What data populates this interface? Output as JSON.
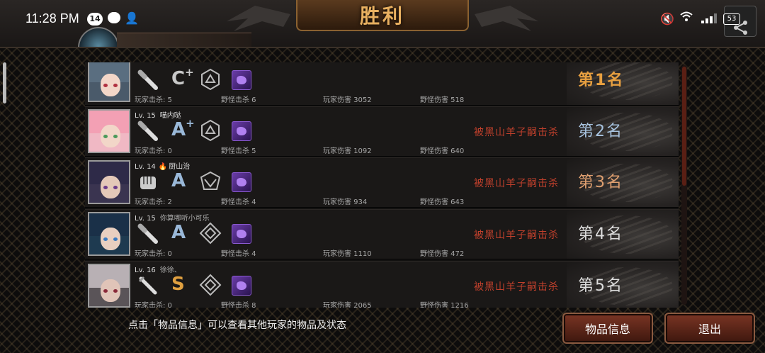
{
  "status_bar": {
    "time": "11:28 PM",
    "notification_count": "14",
    "battery": "53"
  },
  "header": {
    "title": "胜利"
  },
  "players": [
    {
      "level": "",
      "name": "",
      "grade": "C",
      "grade_plus": "+",
      "grade_color": "#c8c8c8",
      "weapon": "bat-icon",
      "player_kills_label": "玩家击杀: 5",
      "monster_kills_label": "野怪击杀 6",
      "player_damage_label": "玩家伤害 3052",
      "monster_damage_label": "野怪伤害 518",
      "killed_by": "",
      "rank": "第1名",
      "rank_color": "#e8a040"
    },
    {
      "level": "Lv. 15",
      "name": "喵内哒",
      "grade": "A",
      "grade_plus": "+",
      "grade_color": "#9ab8d8",
      "weapon": "bat-icon",
      "player_kills_label": "玩家击杀: 0",
      "monster_kills_label": "野怪击杀 5",
      "player_damage_label": "玩家伤害 1092",
      "monster_damage_label": "野怪伤害 640",
      "killed_by": "被黑山羊子嗣击杀",
      "rank": "第2名",
      "rank_color": "#a8c4e0"
    },
    {
      "level": "Lv. 14",
      "name": "厨山治",
      "grade": "A",
      "grade_plus": "",
      "grade_color": "#9ab8d8",
      "weapon": "fist-icon",
      "player_kills_label": "玩家击杀: 2",
      "monster_kills_label": "野怪击杀 4",
      "player_damage_label": "玩家伤害 934",
      "monster_damage_label": "野怪伤害 643",
      "killed_by": "被黑山羊子嗣击杀",
      "rank": "第3名",
      "rank_color": "#e0a070"
    },
    {
      "level": "Lv. 15",
      "name": "你算哪听小可乐",
      "grade": "A",
      "grade_plus": "",
      "grade_color": "#9ab8d8",
      "weapon": "bat-icon",
      "player_kills_label": "玩家击杀: 0",
      "monster_kills_label": "野怪击杀 4",
      "player_damage_label": "玩家伤害 1110",
      "monster_damage_label": "野怪伤害 472",
      "killed_by": "被黑山羊子嗣击杀",
      "rank": "第4名",
      "rank_color": "#dddddd"
    },
    {
      "level": "Lv. 16",
      "name": "徐徐、",
      "grade": "S",
      "grade_plus": "",
      "grade_color": "#e0a040",
      "weapon": "blade-icon",
      "player_kills_label": "玩家击杀: 0",
      "monster_kills_label": "野怪击杀 8",
      "player_damage_label": "玩家伤害 2065",
      "monster_damage_label": "野怪伤害 1216",
      "killed_by": "被黑山羊子嗣击杀",
      "rank": "第5名",
      "rank_color": "#dddddd"
    }
  ],
  "footer": {
    "hint": "点击「物品信息」可以查看其他玩家的物品及状态",
    "items_button": "物品信息",
    "exit_button": "退出"
  }
}
